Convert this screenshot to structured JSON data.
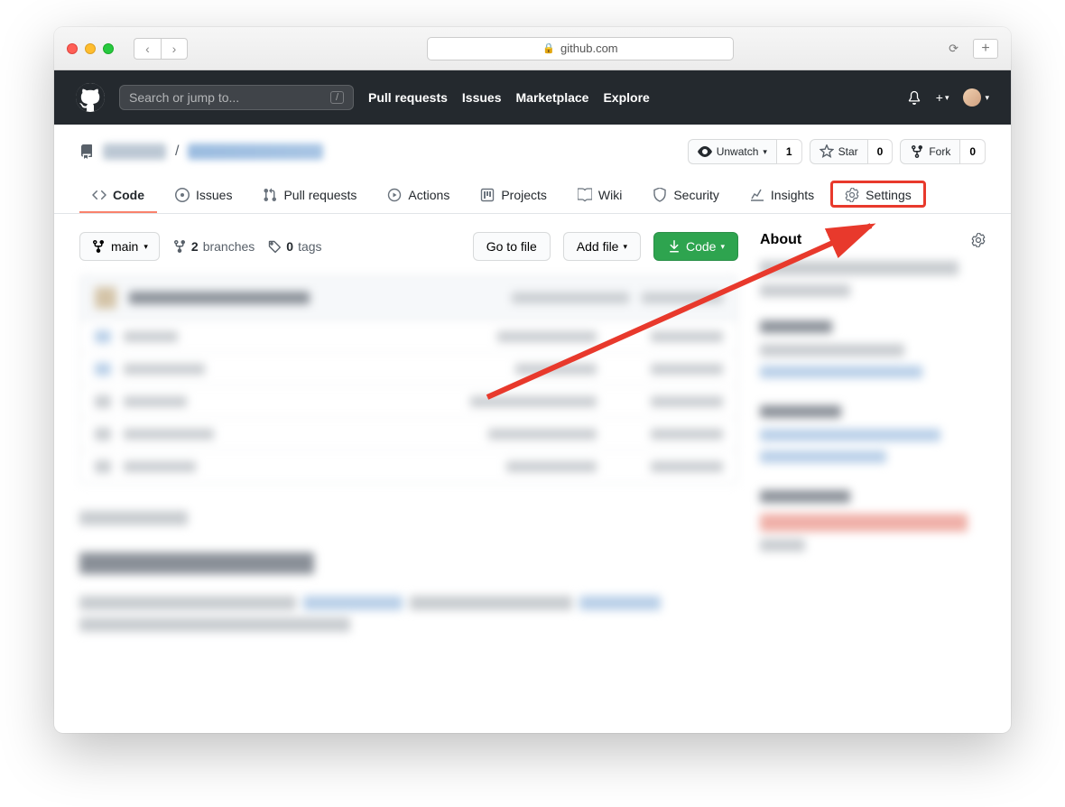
{
  "browser": {
    "url": "github.com"
  },
  "header": {
    "search_placeholder": "Search or jump to...",
    "search_key": "/",
    "nav": {
      "pulls": "Pull requests",
      "issues": "Issues",
      "marketplace": "Marketplace",
      "explore": "Explore"
    }
  },
  "repo": {
    "actions": {
      "unwatch": {
        "label": "Unwatch",
        "count": "1"
      },
      "star": {
        "label": "Star",
        "count": "0"
      },
      "fork": {
        "label": "Fork",
        "count": "0"
      }
    },
    "tabs": {
      "code": "Code",
      "issues": "Issues",
      "pulls": "Pull requests",
      "actions": "Actions",
      "projects": "Projects",
      "wiki": "Wiki",
      "security": "Security",
      "insights": "Insights",
      "settings": "Settings"
    },
    "branch": {
      "default": "main",
      "branches_count": "2",
      "branches_label": "branches",
      "tags_count": "0",
      "tags_label": "tags"
    },
    "buttons": {
      "goto": "Go to file",
      "add": "Add file",
      "code": "Code"
    },
    "about": {
      "heading": "About"
    }
  }
}
